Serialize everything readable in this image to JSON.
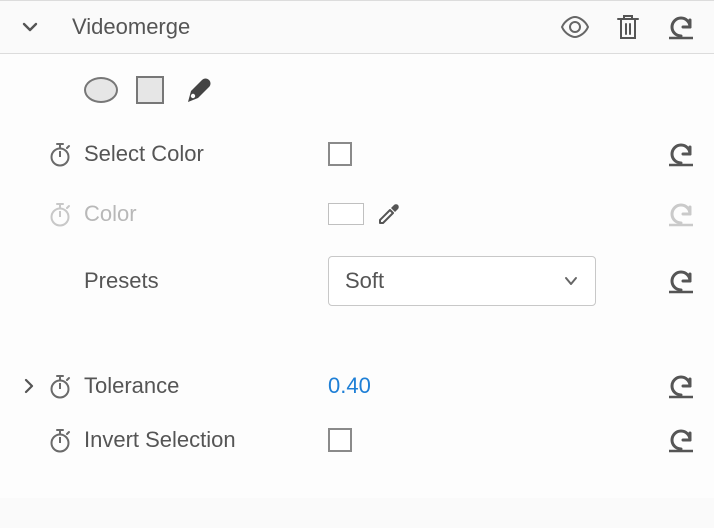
{
  "effect": {
    "title": "Videomerge"
  },
  "props": {
    "select_color": {
      "label": "Select Color"
    },
    "color": {
      "label": "Color"
    },
    "presets": {
      "label": "Presets",
      "value": "Soft"
    },
    "tolerance": {
      "label": "Tolerance",
      "value": "0.40"
    },
    "invert_selection": {
      "label": "Invert Selection"
    }
  }
}
